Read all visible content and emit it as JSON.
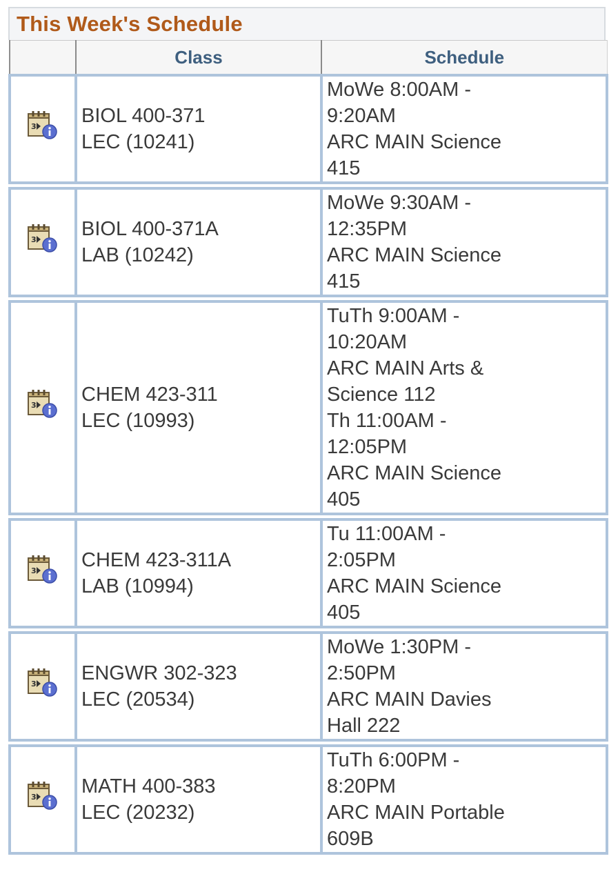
{
  "panel": {
    "title": "This Week's Schedule"
  },
  "table": {
    "headers": [
      "",
      "Class",
      "Schedule"
    ],
    "rows": [
      {
        "icon": "class-details-icon",
        "class_lines": [
          "BIOL 400-371",
          "LEC (10241)"
        ],
        "schedule_lines": [
          "MoWe 8:00AM -",
          "9:20AM",
          "ARC MAIN Science",
          "415"
        ]
      },
      {
        "icon": "class-details-icon",
        "class_lines": [
          "BIOL 400-371A",
          "LAB (10242)"
        ],
        "schedule_lines": [
          "MoWe 9:30AM -",
          "12:35PM",
          "ARC MAIN Science",
          "415"
        ]
      },
      {
        "icon": "class-details-icon",
        "class_lines": [
          "CHEM 423-311",
          "LEC (10993)"
        ],
        "schedule_lines": [
          "TuTh 9:00AM -",
          "10:20AM",
          "ARC MAIN Arts &",
          "Science 112",
          "Th 11:00AM -",
          "12:05PM",
          "ARC MAIN Science",
          "405"
        ]
      },
      {
        "icon": "class-details-icon",
        "class_lines": [
          "CHEM 423-311A",
          "LAB (10994)"
        ],
        "schedule_lines": [
          "Tu 11:00AM -",
          "2:05PM",
          "ARC MAIN Science",
          "405"
        ]
      },
      {
        "icon": "class-details-icon",
        "class_lines": [
          "ENGWR 302-323",
          "LEC (20534)"
        ],
        "schedule_lines": [
          "MoWe 1:30PM -",
          "2:50PM",
          "ARC MAIN Davies",
          "Hall 222"
        ]
      },
      {
        "icon": "class-details-icon",
        "class_lines": [
          "MATH 400-383",
          "LEC (20232)"
        ],
        "schedule_lines": [
          "TuTh 6:00PM -",
          "8:20PM",
          "ARC MAIN Portable",
          "609B"
        ]
      }
    ]
  },
  "colors": {
    "title": "#b05a1a",
    "header_text": "#3e5f7f",
    "cell_border": "#aec4dc",
    "info_badge": "#5b6fd0"
  }
}
